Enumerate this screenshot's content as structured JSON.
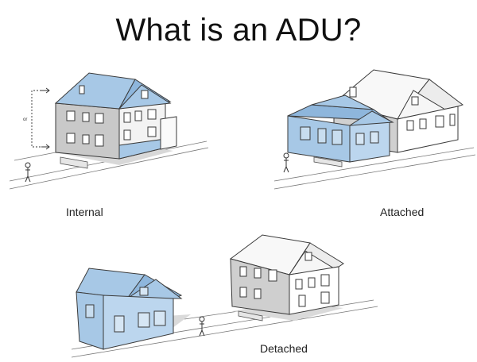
{
  "slide": {
    "title": "What is an ADU?",
    "panels": [
      {
        "id": "internal",
        "label": "Internal",
        "annotation": "or"
      },
      {
        "id": "attached",
        "label": "Attached"
      },
      {
        "id": "detached",
        "label": "Detached"
      }
    ]
  },
  "colors": {
    "adu_blue": "#a7c8e6",
    "adu_blue_dark": "#8eb6dc",
    "wall_gray": "#c9c9c9",
    "wall_light": "#f2f2f2",
    "shadow": "#cfcfcf"
  },
  "icons": [
    "house-icon",
    "person-icon",
    "dimension-arrow-icon"
  ]
}
